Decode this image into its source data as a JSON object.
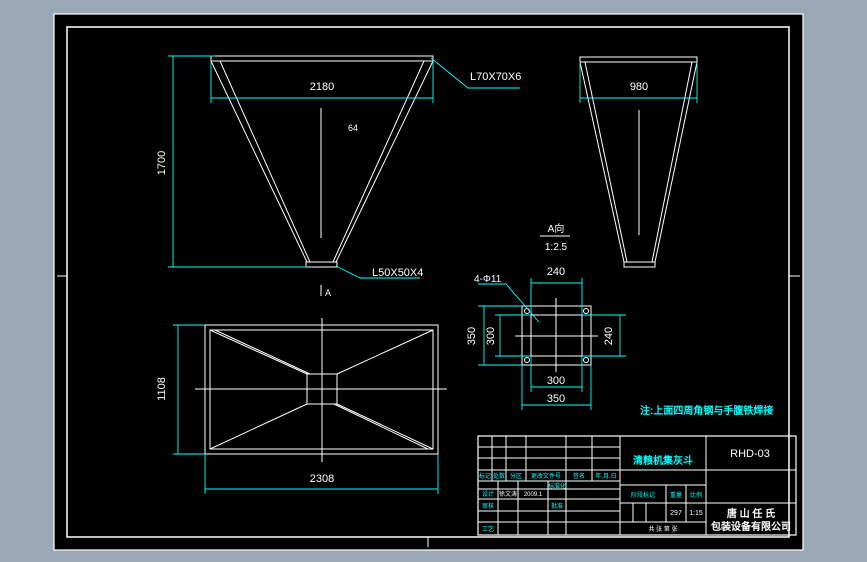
{
  "drawing": {
    "front_view": {
      "top_width": "2180",
      "height": "1700",
      "top_angle": "L70X70X6",
      "center_mark": "64",
      "bottom_angle": "L50X50X4",
      "view_marker": "A"
    },
    "side_view": {
      "top_width": "980"
    },
    "plan_view": {
      "width": "2308",
      "depth": "1108"
    },
    "detail_view": {
      "title": "A向",
      "scale": "1:2.5",
      "holes": "4-Φ11",
      "inner_top": "240",
      "inner_right": "240",
      "outer_left_1": "350",
      "outer_left_2": "300",
      "bottom_inner": "300",
      "bottom_outer": "350"
    },
    "note": "注:上面四周角钢与手腹铁焊接"
  },
  "title_block": {
    "part_name": "清粮机集灰斗",
    "drawing_no": "RHD-03",
    "sheet_value": "297",
    "scale_value": "1:15",
    "scale_label": "比例",
    "weight_label": "重量",
    "stage_label": "阶段标记",
    "row_labels": [
      "标记",
      "处数",
      "分区",
      "更改文件号",
      "签名",
      "年.月.日"
    ],
    "design_label": "设计",
    "standard_label": "标准化",
    "designer": "徐文涛",
    "date": "2009.1",
    "check_label": "审核",
    "craft_label": "工艺",
    "approve_label": "批准",
    "sheet_info": "共 张 第 张",
    "company_line1": "唐 山 任 氏",
    "company_line2": "包装设备有限公司"
  }
}
